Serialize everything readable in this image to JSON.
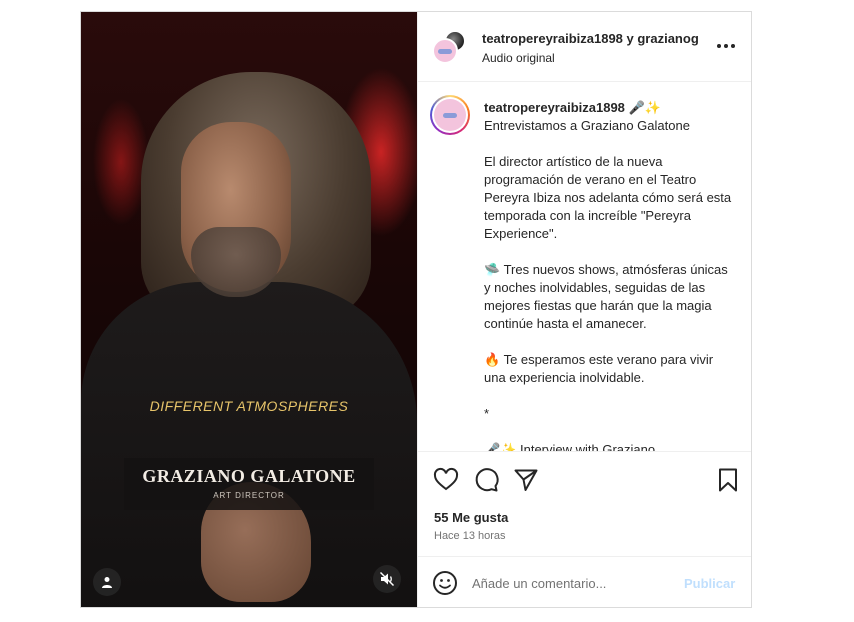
{
  "video": {
    "caption_overlay": "DIFFERENT ATMOSPHERES",
    "name_title": "GRAZIANO GALATONE",
    "name_subtitle": "ART DIRECTOR",
    "icons": {
      "user": "user-icon",
      "mute": "muted-speaker-icon"
    }
  },
  "header": {
    "usernames": "teatropereyraibiza1898 y grazianog",
    "audio": "Audio original",
    "more_icon": "more-horizontal-icon"
  },
  "caption": {
    "username": "teatropereyraibiza1898",
    "title_emojis": "🎤✨",
    "title": "Entrevistamos a Graziano Galatone",
    "paragraph1": "El director artístico de la nueva programación de verano en el Teatro Pereyra Ibiza nos adelanta cómo será esta temporada con la increíble \"Pereyra Experience\".",
    "paragraph2": "🛸 Tres nuevos shows, atmósferas únicas y noches inolvidables, seguidas de las mejores fiestas que harán que la magia continúe hasta el amanecer.",
    "paragraph3": "🔥 Te esperamos este verano para vivir una experiencia inolvidable.",
    "separator": "*",
    "paragraph4": "🎤✨ Interview with Graziano"
  },
  "actions": {
    "likes": "55 Me gusta",
    "time": "Hace 13 horas",
    "icons": [
      "heart-icon",
      "comment-icon",
      "share-icon",
      "bookmark-icon"
    ]
  },
  "comment": {
    "placeholder": "Añade un comentario...",
    "publish_label": "Publicar",
    "emoji_icon": "emoji-icon"
  },
  "colors": {
    "accent_link": "#0095f6",
    "publish_disabled": "#c0dffd",
    "border": "#dbdbdb",
    "caption_overlay": "#e7c46a"
  }
}
